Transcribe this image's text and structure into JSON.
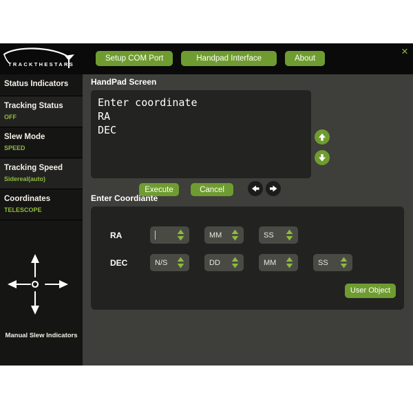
{
  "header": {
    "logo_text": "TRACKTHESTARS",
    "nav": [
      {
        "label": "Setup COM Port",
        "name": "setup-com-port"
      },
      {
        "label": "Handpad Interface",
        "name": "handpad-interface"
      },
      {
        "label": "About",
        "name": "about"
      }
    ],
    "close_label": "×"
  },
  "sidebar": {
    "heading": "Status Indicators",
    "items": [
      {
        "title": "Tracking Status",
        "value": "OFF"
      },
      {
        "title": "Slew Mode",
        "value": "SPEED"
      },
      {
        "title": "Tracking Speed",
        "value": "Sidereal(auto)"
      },
      {
        "title": "Coordinates",
        "value": "TELESCOPE"
      }
    ],
    "slew_label": "Manual Slew Indicators"
  },
  "handpad": {
    "section_label": "HandPad Screen",
    "lines": [
      "Enter coordinate",
      "RA",
      "DEC"
    ],
    "execute_label": "Execute",
    "cancel_label": "Cancel"
  },
  "coordinates": {
    "section_label": "Enter Coordiante",
    "ra_label": "RA",
    "dec_label": "DEC",
    "ra_fields": [
      {
        "value": "",
        "name": "ra-hh-field",
        "focused": true
      },
      {
        "value": "MM",
        "name": "ra-mm-field",
        "focused": false
      },
      {
        "value": "SS",
        "name": "ra-ss-field",
        "focused": false
      }
    ],
    "dec_fields": [
      {
        "value": "N/S",
        "name": "dec-ns-field",
        "focused": false
      },
      {
        "value": "DD",
        "name": "dec-dd-field",
        "focused": false
      },
      {
        "value": "MM",
        "name": "dec-mm-field",
        "focused": false
      },
      {
        "value": "SS",
        "name": "dec-ss-field",
        "focused": false
      }
    ],
    "user_object_label": "User Object"
  },
  "colors": {
    "accent_green": "#6f9c30",
    "status_green": "#8fbb3c",
    "app_bg": "#3e3e3a",
    "sidebar_bg": "#151514",
    "panel_bg": "#222221"
  }
}
